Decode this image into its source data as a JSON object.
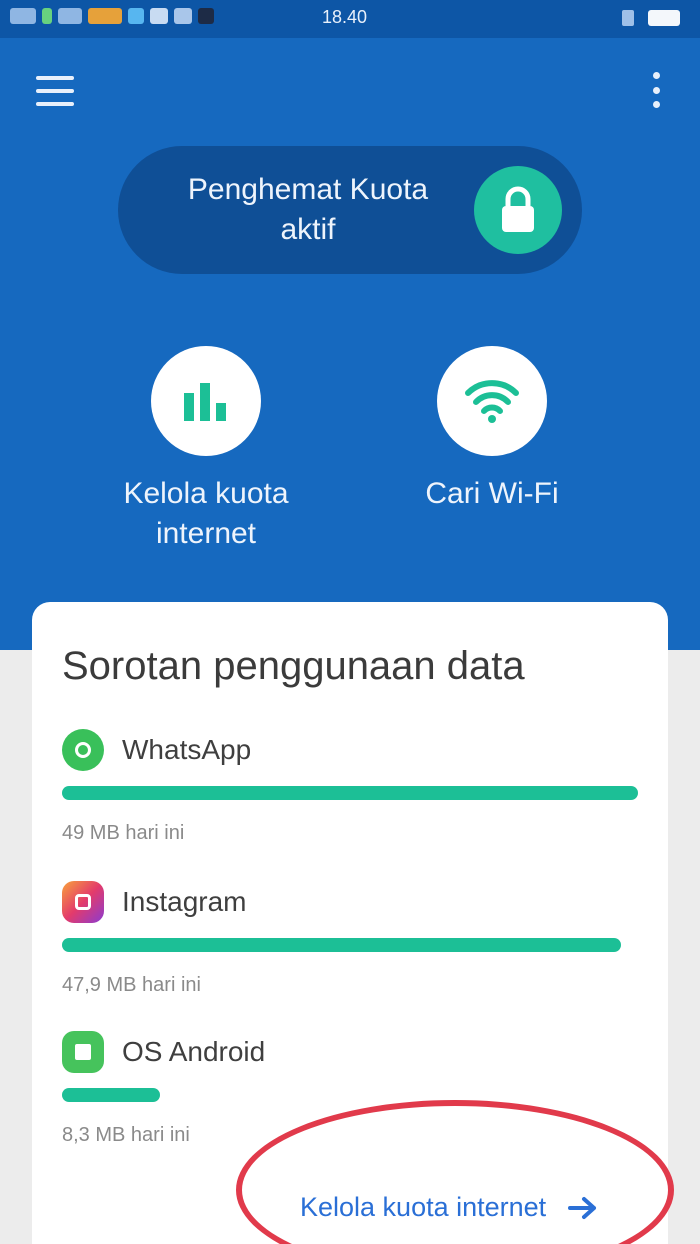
{
  "status_bar": {
    "time": "18.40"
  },
  "header": {
    "saver_label": "Penghemat Kuota aktif"
  },
  "actions": [
    {
      "label": "Kelola kuota internet",
      "icon": "bar-chart-icon"
    },
    {
      "label": "Cari Wi-Fi",
      "icon": "wifi-icon"
    }
  ],
  "card": {
    "title": "Sorotan penggunaan data",
    "items": [
      {
        "app": "WhatsApp",
        "amount": "49 MB hari ini",
        "usage_fraction": 1.0,
        "icon": "whatsapp-icon"
      },
      {
        "app": "Instagram",
        "amount": "47,9 MB hari ini",
        "usage_fraction": 0.97,
        "icon": "instagram-icon"
      },
      {
        "app": "OS Android",
        "amount": "8,3 MB hari ini",
        "usage_fraction": 0.17,
        "icon": "android-os-icon"
      }
    ],
    "footer_link": "Kelola kuota internet"
  },
  "colors": {
    "primary_blue": "#1669bf",
    "accent_green": "#1cbf96",
    "link_blue": "#2a6fd6",
    "highlight_red": "#e13a4b"
  }
}
